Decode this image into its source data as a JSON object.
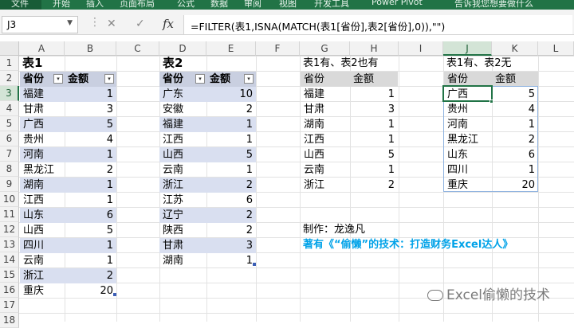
{
  "ribbon": {
    "tabs": [
      "文件",
      "开始",
      "插入",
      "页面布局",
      "公式",
      "数据",
      "审阅",
      "视图",
      "开发工具",
      "Power Pivot",
      "告诉我您想要做什么"
    ]
  },
  "name_box": "J3",
  "formula": "=FILTER(表1,ISNA(MATCH(表1[省份],表2[省份],0)),\"\")",
  "columns": [
    "A",
    "B",
    "C",
    "D",
    "E",
    "F",
    "G",
    "H",
    "I",
    "J",
    "K",
    "L"
  ],
  "rows": [
    "1",
    "2",
    "3",
    "4",
    "5",
    "6",
    "7",
    "8",
    "9",
    "10",
    "11",
    "12",
    "13",
    "14",
    "15",
    "16",
    "17",
    "18"
  ],
  "table1": {
    "title": "表1",
    "headers": [
      "省份",
      "金额"
    ],
    "rows": [
      [
        "福建",
        "1"
      ],
      [
        "甘肃",
        "3"
      ],
      [
        "广西",
        "5"
      ],
      [
        "贵州",
        "4"
      ],
      [
        "河南",
        "1"
      ],
      [
        "黑龙江",
        "2"
      ],
      [
        "湖南",
        "1"
      ],
      [
        "江西",
        "1"
      ],
      [
        "山东",
        "6"
      ],
      [
        "山西",
        "5"
      ],
      [
        "四川",
        "1"
      ],
      [
        "云南",
        "1"
      ],
      [
        "浙江",
        "2"
      ],
      [
        "重庆",
        "20"
      ]
    ]
  },
  "table2": {
    "title": "表2",
    "headers": [
      "省份",
      "金额"
    ],
    "rows": [
      [
        "广东",
        "10"
      ],
      [
        "安徽",
        "2"
      ],
      [
        "福建",
        "1"
      ],
      [
        "江西",
        "1"
      ],
      [
        "山西",
        "5"
      ],
      [
        "云南",
        "1"
      ],
      [
        "浙江",
        "2"
      ],
      [
        "江苏",
        "6"
      ],
      [
        "辽宁",
        "2"
      ],
      [
        "陕西",
        "2"
      ],
      [
        "甘肃",
        "3"
      ],
      [
        "湖南",
        "1"
      ]
    ]
  },
  "both": {
    "title": "表1有、表2也有",
    "headers": [
      "省份",
      "金额"
    ],
    "rows": [
      [
        "福建",
        "1"
      ],
      [
        "甘肃",
        "3"
      ],
      [
        "湖南",
        "1"
      ],
      [
        "江西",
        "1"
      ],
      [
        "山西",
        "5"
      ],
      [
        "云南",
        "1"
      ],
      [
        "浙江",
        "2"
      ]
    ]
  },
  "only1": {
    "title": "表1有、表2无",
    "headers": [
      "省份",
      "金额"
    ],
    "rows": [
      [
        "广西",
        "5"
      ],
      [
        "贵州",
        "4"
      ],
      [
        "河南",
        "1"
      ],
      [
        "黑龙江",
        "2"
      ],
      [
        "山东",
        "6"
      ],
      [
        "四川",
        "1"
      ],
      [
        "重庆",
        "20"
      ]
    ]
  },
  "credit": {
    "maker": "制作：龙逸凡",
    "book": "著有《“偷懒”的技术：打造财务Excel达人》"
  },
  "watermark": "Excel偷懒的技术",
  "colors": {
    "accent": "#217346",
    "header_band": "#c9cfe0",
    "row_band": "#d9dff0",
    "link_blue": "#00a2e8"
  }
}
